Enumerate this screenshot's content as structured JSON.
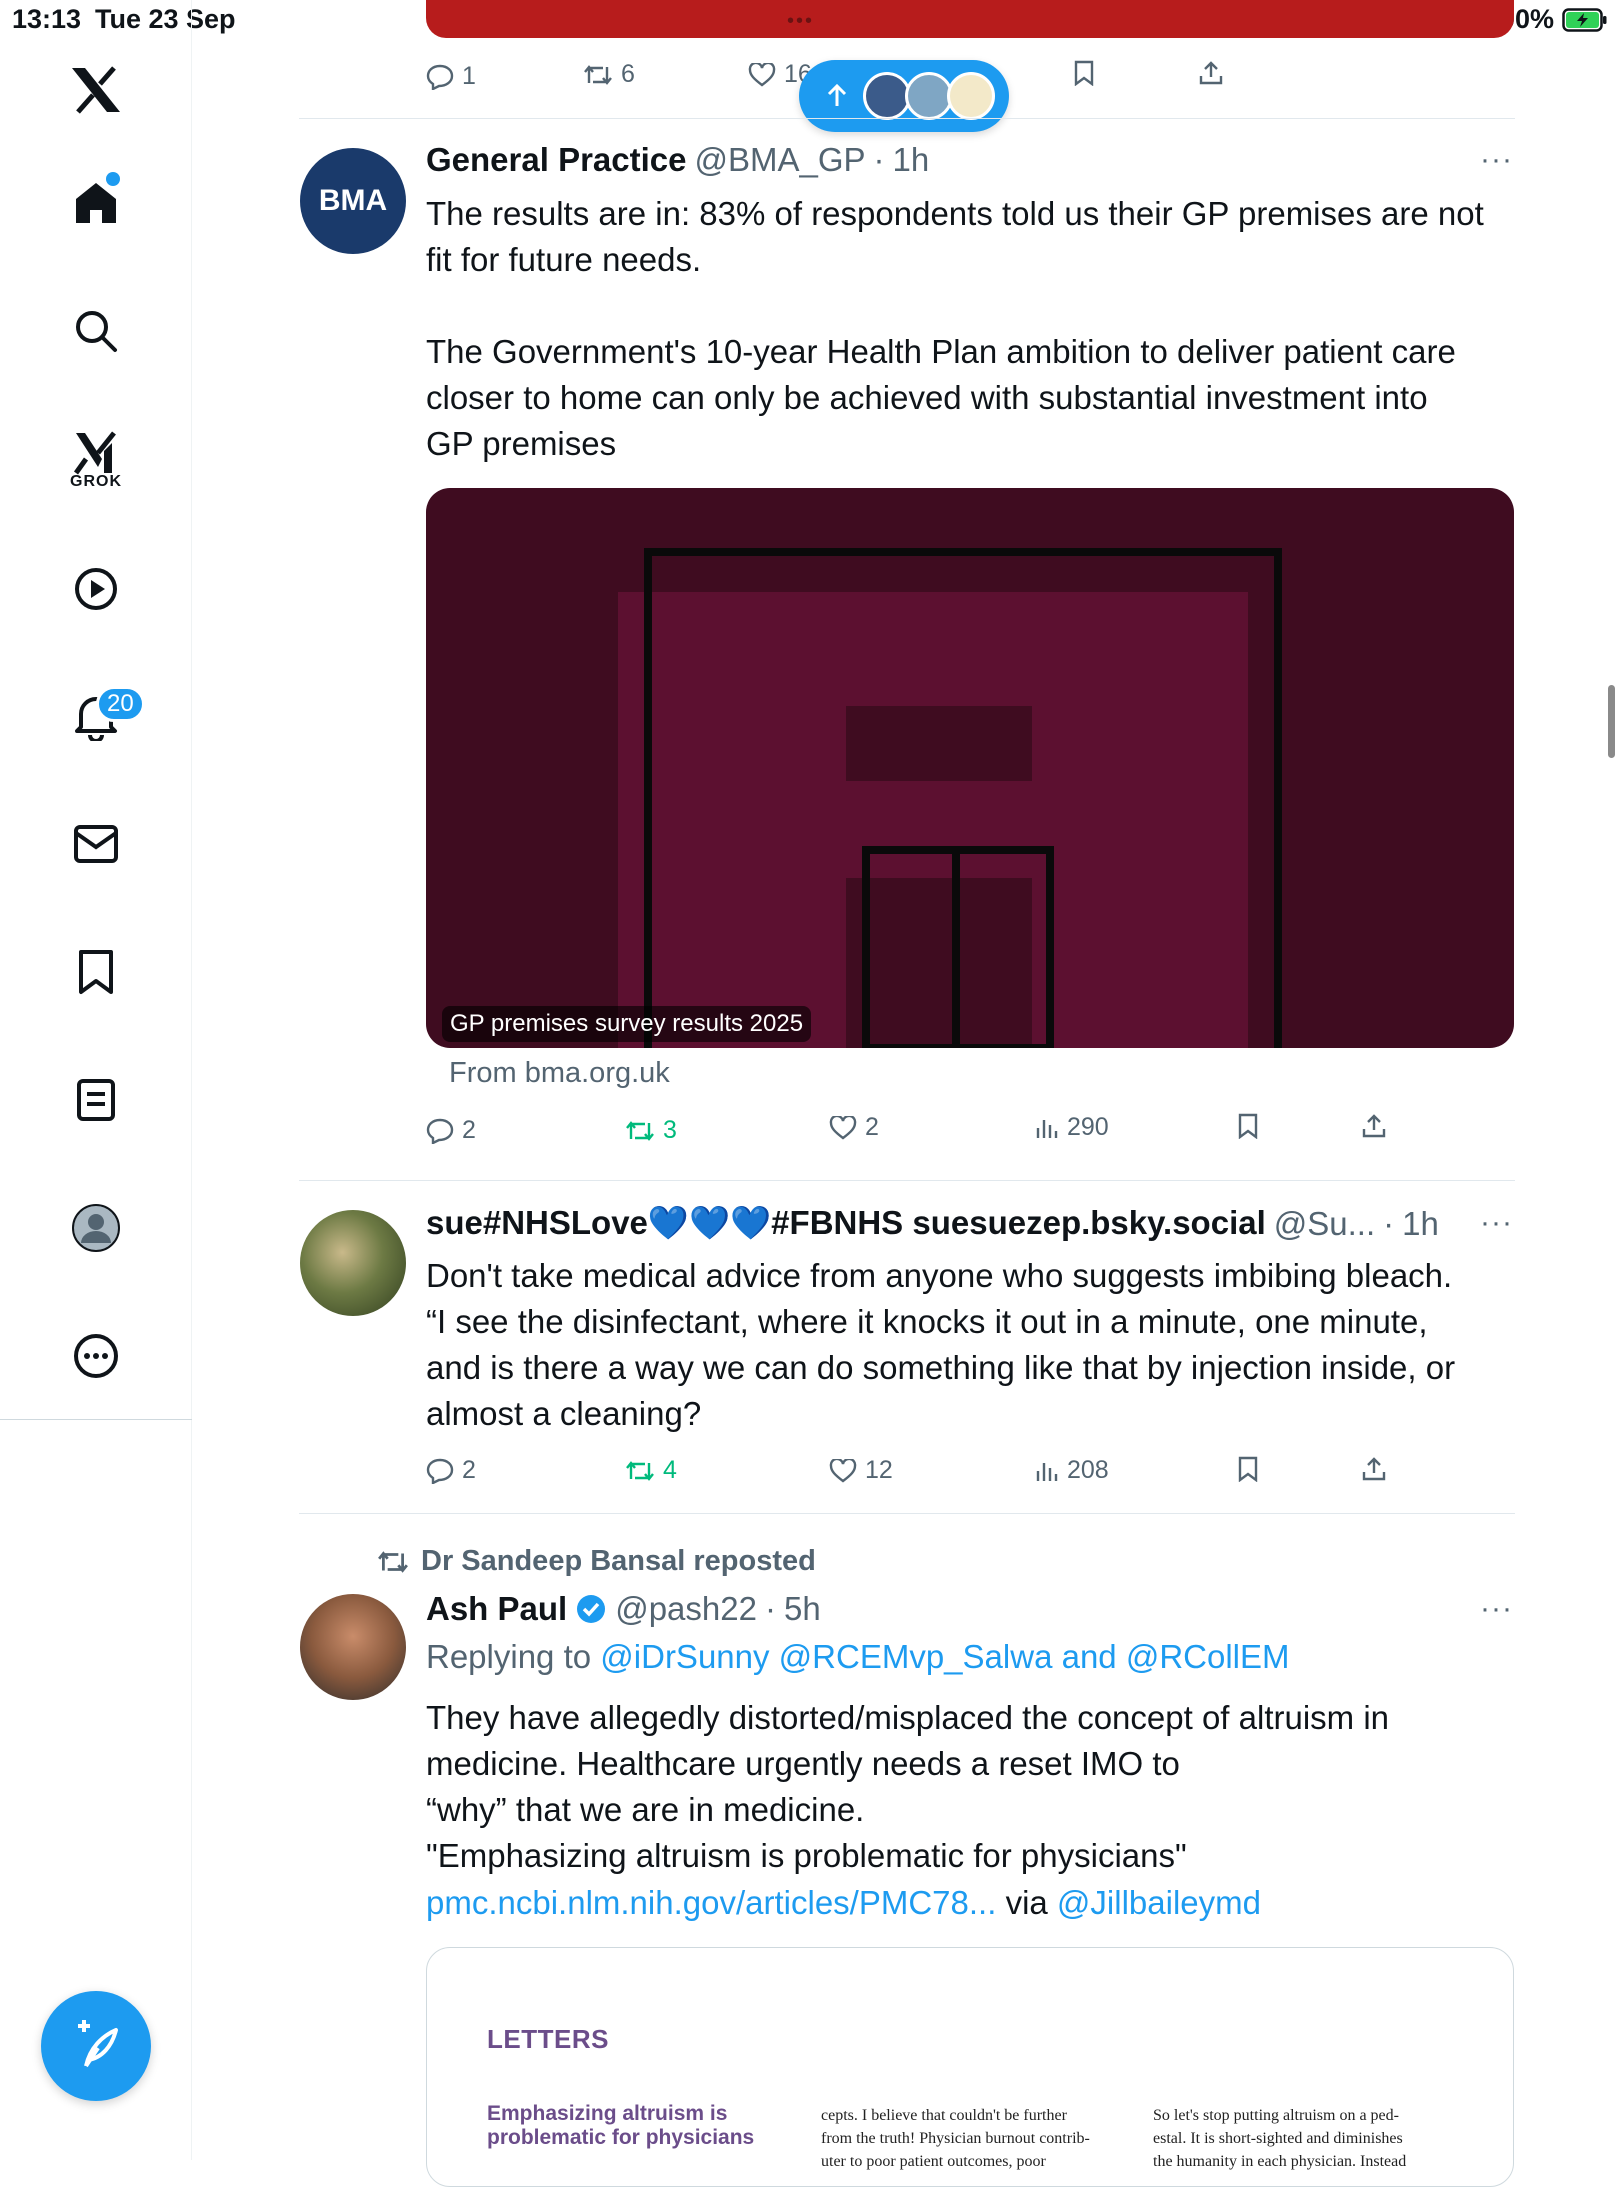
{
  "status_bar": {
    "time": "13:13",
    "date": "Tue 23 Sep",
    "battery": "100%"
  },
  "sidebar": {
    "grok_label": "GROK",
    "notifications_badge": "20"
  },
  "colors": {
    "accent": "#1d9bf0",
    "repost_green": "#00ba7c",
    "muted": "#536471"
  },
  "prev_tweet": {
    "replies": "1",
    "reposts": "6",
    "likes": "16"
  },
  "tweet1": {
    "name": "General Practice",
    "handle": "@BMA_GP",
    "time": "1h",
    "avatar_text": "BMA",
    "text": "The results are in: 83% of respondents told us their GP premises are not\nfit for future needs.\n\nThe Government's 10-year Health Plan ambition to deliver patient care\ncloser to home can only be achieved with substantial investment into\nGP premises",
    "media_caption": "GP premises survey results 2025",
    "from": "From bma.org.uk",
    "replies": "2",
    "reposts": "3",
    "likes": "2",
    "views": "290"
  },
  "tweet2": {
    "name": "sue#NHSLove💙💙💙#FBNHS suesuezep.bsky.social",
    "handle": "@Su...",
    "time": "1h",
    "text": "Don't take medical advice from anyone who suggests imbibing bleach.\n“I see the disinfectant, where it knocks it out in a minute, one minute,\nand is there a way we can do something like that by injection inside, or\nalmost a cleaning?",
    "replies": "2",
    "reposts": "4",
    "likes": "12",
    "views": "208"
  },
  "tweet3": {
    "repost_by": "Dr Sandeep Bansal reposted",
    "name": "Ash Paul",
    "handle": "@pash22",
    "time": "5h",
    "replying_prefix": "Replying to",
    "replying_targets": "@iDrSunny @RCEMvp_Salwa and @RCollEM",
    "text": "They have allegedly distorted/misplaced the concept of altruism in\nmedicine. Healthcare urgently needs a reset IMO to\n“why” that we are in medicine.\n\"Emphasizing altruism is problematic for physicians\"",
    "link": "pmc.ncbi.nlm.nih.gov/articles/PMC78...",
    "via": "via",
    "via_handle": "@Jillbaileymd",
    "doc_heading": "LETTERS",
    "doc_subheading": "Emphasizing altruism is problematic for physicians",
    "doc_col1": "cepts. I believe that couldn't be further\nfrom the truth! Physician burnout contrib-\nuter to poor patient outcomes, poor",
    "doc_col2": "So let's stop putting altruism on a ped-\nestal. It is short-sighted and diminishes\nthe humanity in each physician. Instead"
  }
}
